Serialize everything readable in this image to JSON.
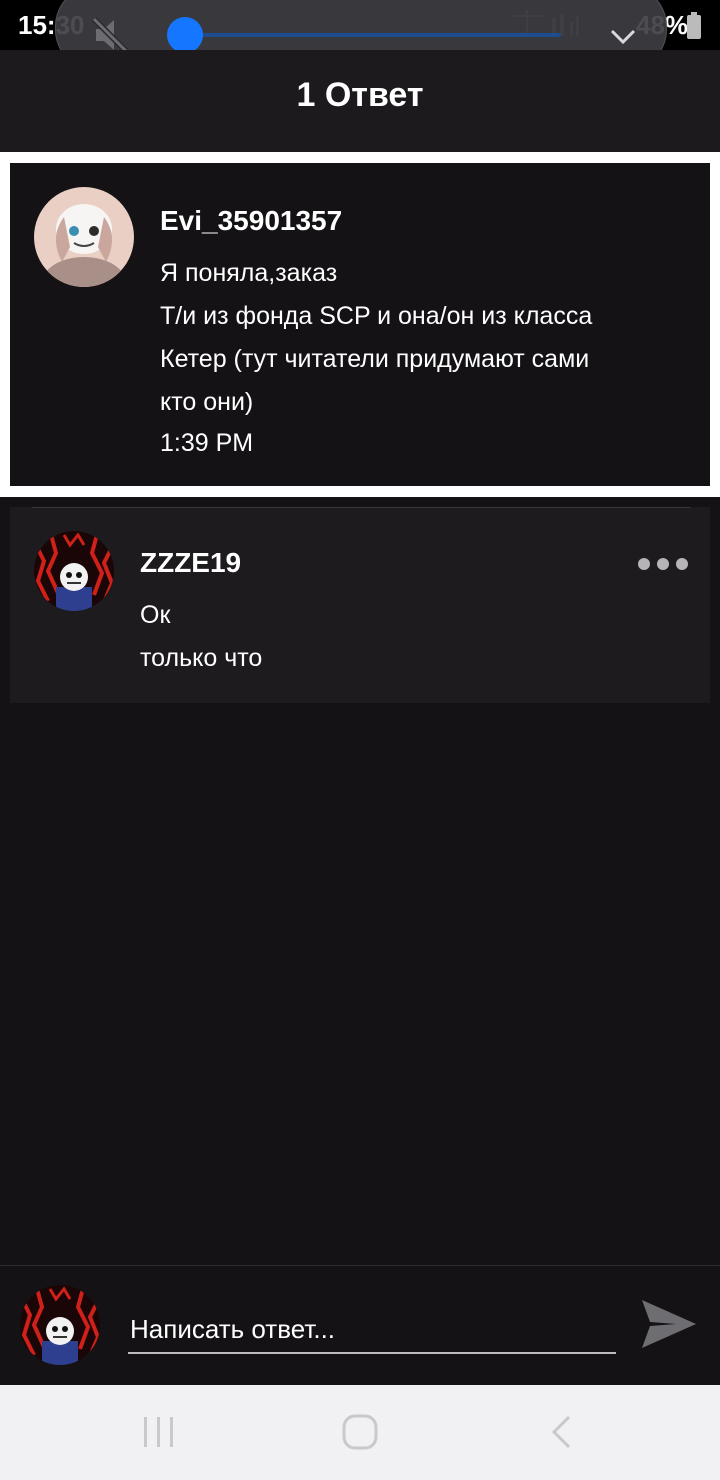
{
  "status_bar": {
    "time": "15:30",
    "battery": "48%"
  },
  "volume_panel": {
    "level_fraction": 0.04,
    "mute_icon": "speaker-muted-icon",
    "expand_icon": "chevron-down-icon"
  },
  "header": {
    "title": "1 Ответ"
  },
  "parent_comment": {
    "author": "Evi_35901357",
    "lines": [
      "Я поняла,заказ",
      "Т/и из фонда SCP и она/он из класса",
      "Кетер (тут читатели придумают сами",
      "кто они)"
    ],
    "time": "1:39 PM"
  },
  "reply": {
    "author": "ZZZE19",
    "text": "Ок",
    "time": "только что",
    "more_icon": "more-horizontal-icon"
  },
  "composer": {
    "placeholder": "Написать ответ...",
    "send_icon": "send-icon"
  },
  "nav_bar": {
    "icons": [
      "recent-apps-icon",
      "home-icon",
      "back-icon"
    ]
  },
  "colors": {
    "background": "#141215",
    "card": "#1d1b1e",
    "accent": "#1577ff"
  }
}
